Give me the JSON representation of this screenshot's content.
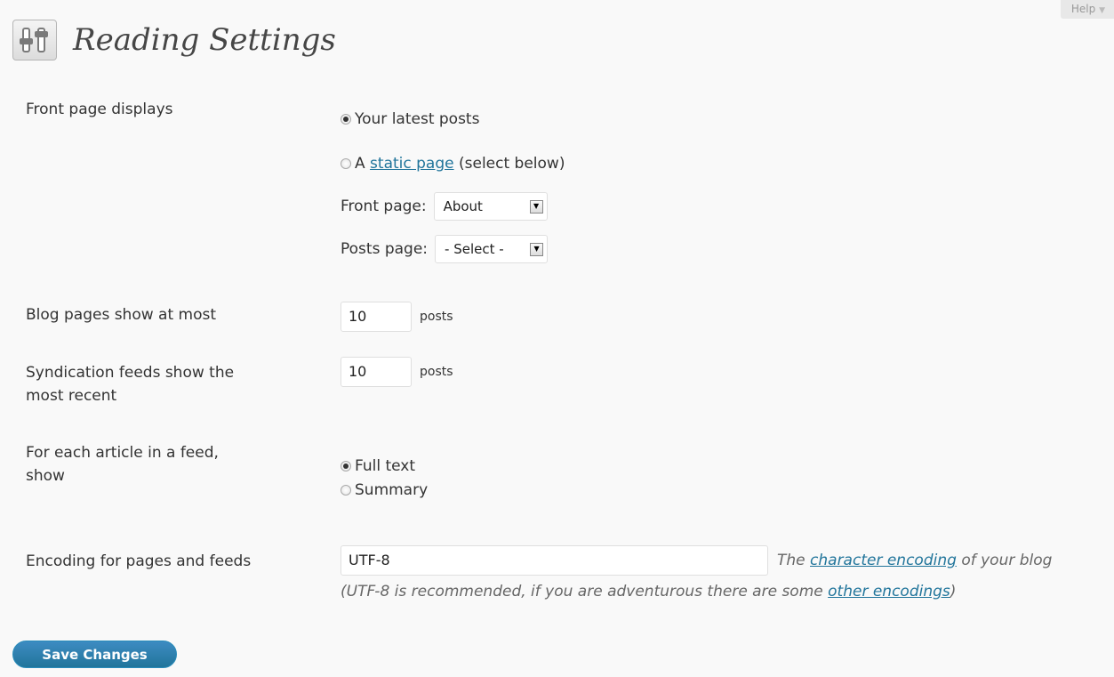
{
  "help": {
    "label": "Help",
    "arrow": "▼"
  },
  "page": {
    "title": "Reading Settings"
  },
  "front_page": {
    "label": "Front page displays",
    "option_latest": "Your latest posts",
    "option_static_prefix": "A",
    "option_static_link": "static page",
    "option_static_suffix": "(select below)",
    "front_page_label": "Front page:",
    "front_page_value": "About",
    "posts_page_label": "Posts page:",
    "posts_page_value": "- Select -"
  },
  "blog_pages": {
    "label": "Blog pages show at most",
    "value": "10",
    "unit": "posts"
  },
  "syndication": {
    "label_line1": "Syndication feeds show the",
    "label_line2": "most recent",
    "value": "10",
    "unit": "posts"
  },
  "feed_article": {
    "label_line1": "For each article in a feed,",
    "label_line2": "show",
    "option_full": "Full text",
    "option_summary": "Summary"
  },
  "encoding": {
    "label": "Encoding for pages and feeds",
    "value": "UTF-8",
    "desc_prefix": "The",
    "desc_link": "character encoding",
    "desc_suffix": "of your blog",
    "note_prefix": "(UTF-8 is recommended, if you are adventurous there are some",
    "note_link": "other encodings",
    "note_suffix": ")"
  },
  "actions": {
    "save_label": "Save Changes"
  }
}
